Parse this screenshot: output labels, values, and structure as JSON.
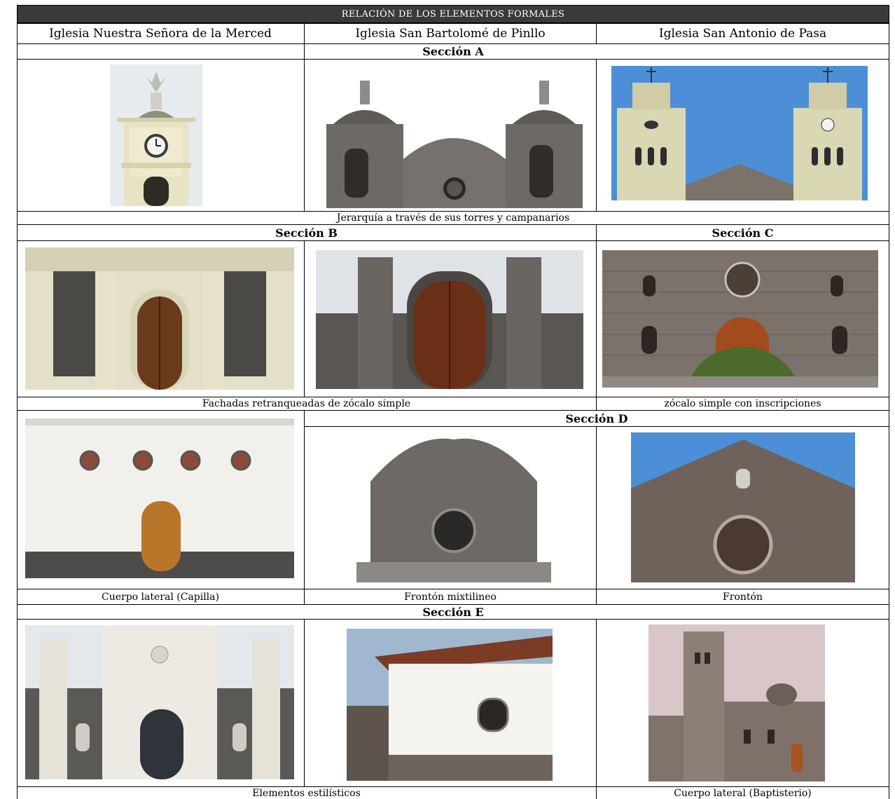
{
  "header": {
    "title": "RELACIÓN DE LOS ELEMENTOS FORMALES",
    "columns": [
      "Iglesia Nuestra Señora de la Merced",
      "Iglesia San Bartolomé de Pinllo",
      "Iglesia San Antonio de Pasa"
    ]
  },
  "sections": {
    "a": "Sección A",
    "b": "Sección B",
    "c": "Sección C",
    "d": "Sección D",
    "e": "Sección E"
  },
  "captions": {
    "a": "Jerarquía a través de sus torres y campanarios",
    "b": "Fachadas retranqueadas de zócalo simple",
    "c": "zócalo simple con inscripciones",
    "lateral_capilla": "Cuerpo lateral (Capilla)",
    "fronton_mixtilineo": "Frontón mixtilineo",
    "fronton": "Frontón",
    "estilisticos": "Elementos estilísticos",
    "lateral_baptisterio": "Cuerpo lateral (Baptisterio)"
  },
  "colors": {
    "title_bar": "#3a3a3a",
    "stone_gray": "#6e6a66",
    "cream": "#e9e4c9",
    "sky": "#4d8fd6",
    "wood": "#8a4b22"
  }
}
